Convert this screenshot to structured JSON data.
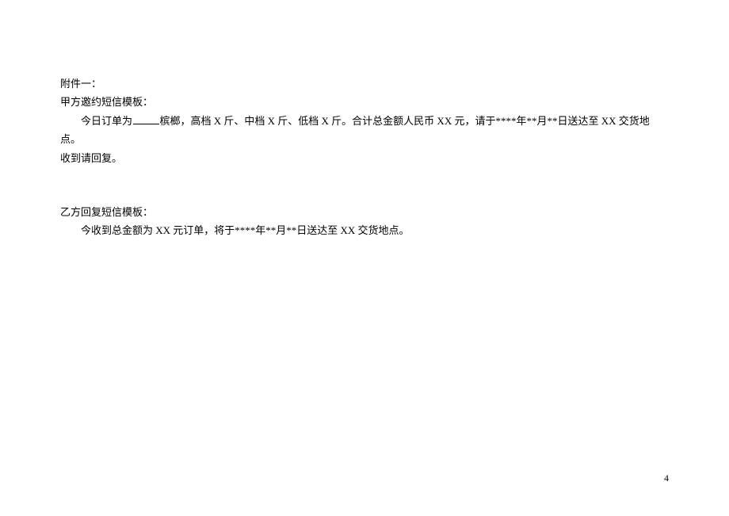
{
  "attachment": {
    "title": "附件一："
  },
  "section_a": {
    "header": "甲方邀约短信模板：",
    "body_part1": "今日订单为",
    "body_part2": "槟榔，高档 X 斤、中档 X 斤、低档 X 斤。合计总金额人民币 XX 元，请于****年**月**日送达至 XX 交货地点。",
    "body_line2": "收到请回复。"
  },
  "section_b": {
    "header": "乙方回复短信模板：",
    "body": "今收到总金额为 XX 元订单，将于****年**月**日送达至 XX 交货地点。"
  },
  "page_number": "4"
}
